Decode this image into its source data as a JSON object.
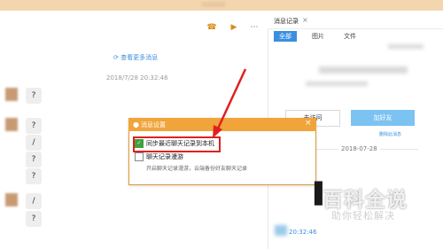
{
  "chat": {
    "more_messages": "查看更多消息",
    "timestamp": "2018/7/28 20:32:46",
    "bubbles": [
      "?",
      "?",
      "/",
      "?",
      "?",
      "/",
      "?"
    ]
  },
  "history_panel": {
    "title": "消息记录",
    "close": "×",
    "tabs": [
      "全部",
      "图片",
      "文件"
    ],
    "visit_button": "去访问",
    "add_friend_button": "加好友",
    "small_link": "删除此消息",
    "date": "2018-07-28",
    "bottom_time": "20:32:46"
  },
  "dialog": {
    "title": "消息设置",
    "close": "×",
    "option_sync": "同步最近聊天记录到本机",
    "option_roaming": "聊天记录漫游",
    "roaming_hint": "开启聊天记录漫游，云端备份好友聊天记录",
    "sync_checked": true,
    "roaming_checked": false
  },
  "watermark": {
    "main": "百科全说",
    "sub": "助你轻松解决"
  },
  "icons": {
    "phone": "phone-icon",
    "video": "video-icon",
    "more": "more-icon",
    "refresh": "refresh-icon",
    "checkmark": "check-icon"
  },
  "colors": {
    "accent_orange": "#f0a43a",
    "accent_blue": "#3b8fe0",
    "annotation_red": "#e02020",
    "checkbox_green": "#3fa03f"
  }
}
